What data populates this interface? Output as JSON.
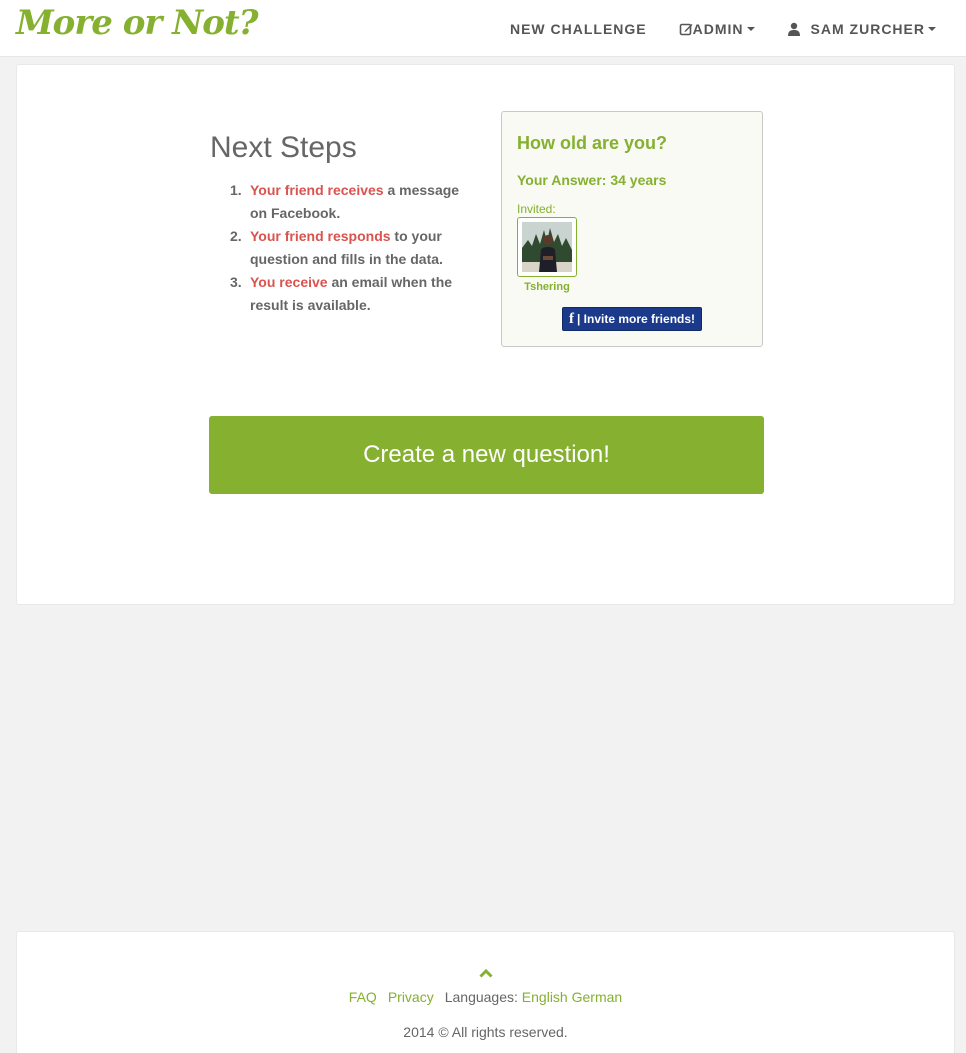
{
  "brand": {
    "name": "More or Not?"
  },
  "nav": {
    "new_challenge": "NEW CHALLENGE",
    "admin": "ADMIN",
    "user": "SAM ZURCHER"
  },
  "steps": {
    "title": "Next Steps",
    "items": [
      {
        "num": "1.",
        "highlight": "Your friend receives",
        "rest": " a message on Facebook."
      },
      {
        "num": "2.",
        "highlight": "Your friend responds",
        "rest": " to your question and fills in the data."
      },
      {
        "num": "3.",
        "highlight": "You receive",
        "rest": " an email when the result is available."
      }
    ]
  },
  "question": {
    "title": "How old are you?",
    "answer": "Your Answer: 34 years",
    "invited_label": "Invited:",
    "friends": [
      {
        "name": "Tshering"
      }
    ],
    "invite_button": "| Invite more friends!",
    "invite_icon": "f"
  },
  "create_button": "Create a new question!",
  "footer": {
    "faq": "FAQ",
    "privacy": "Privacy",
    "languages_label": "Languages:",
    "lang_english": "English",
    "lang_german": "German",
    "copyright": "2014 © All rights reserved."
  },
  "colors": {
    "brand_green": "#85b030",
    "highlight_red": "#d9534f",
    "facebook_blue": "#1b3a8b"
  }
}
